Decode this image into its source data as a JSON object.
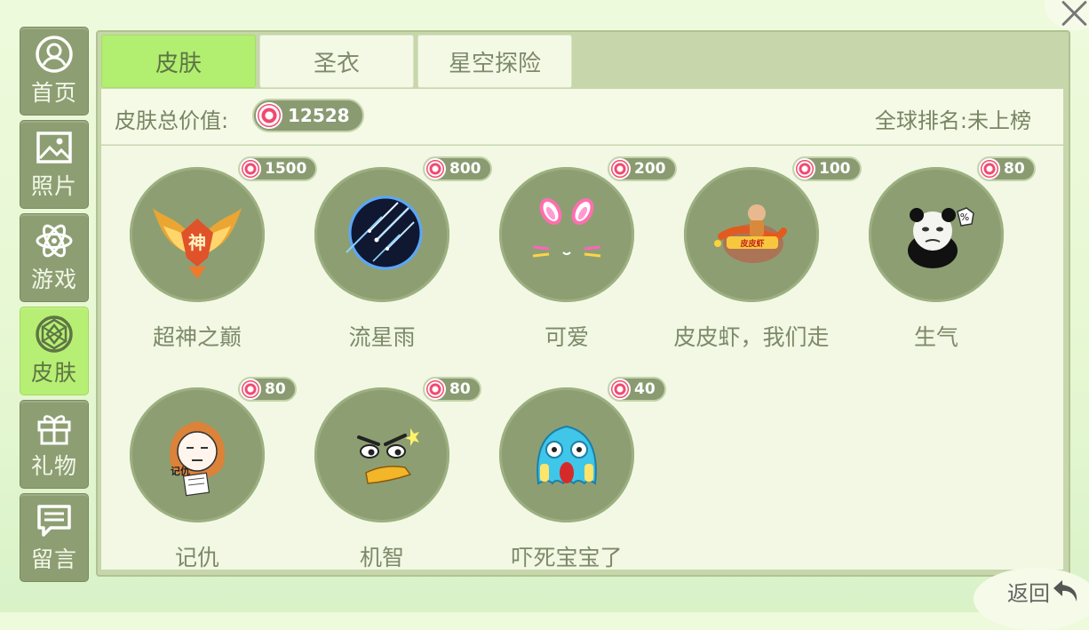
{
  "sidebar": {
    "items": [
      {
        "label": "首页",
        "icon": "user-circle-icon",
        "active": false
      },
      {
        "label": "照片",
        "icon": "picture-icon",
        "active": false
      },
      {
        "label": "游戏",
        "icon": "atom-icon",
        "active": false
      },
      {
        "label": "皮肤",
        "icon": "gem-icon",
        "active": true
      },
      {
        "label": "礼物",
        "icon": "gift-icon",
        "active": false
      },
      {
        "label": "留言",
        "icon": "message-icon",
        "active": false
      }
    ]
  },
  "tabs": [
    {
      "label": "皮肤",
      "active": true
    },
    {
      "label": "圣衣",
      "active": false
    },
    {
      "label": "星空探险",
      "active": false
    }
  ],
  "summary": {
    "total_label": "皮肤总价值:",
    "total_value": "12528",
    "rank": "全球排名:未上榜"
  },
  "skins": [
    {
      "name": "超神之巅",
      "price": "1500",
      "icon": "golden-wings-icon"
    },
    {
      "name": "流星雨",
      "price": "800",
      "icon": "meteor-shower-icon"
    },
    {
      "name": "可爱",
      "price": "200",
      "icon": "bunny-ears-icon"
    },
    {
      "name": "皮皮虾，我们走",
      "price": "100",
      "icon": "mantis-shrimp-rider-icon"
    },
    {
      "name": "生气",
      "price": "80",
      "icon": "angry-panda-icon"
    },
    {
      "name": "记仇",
      "price": "80",
      "icon": "grudge-face-icon"
    },
    {
      "name": "机智",
      "price": "80",
      "icon": "smug-face-icon"
    },
    {
      "name": "吓死宝宝了",
      "price": "40",
      "icon": "scared-ghost-icon"
    }
  ],
  "back_label": "返回",
  "colors": {
    "accent": "#b2ee6f",
    "panel": "#c7d6ab",
    "tile": "#8d9f72",
    "coin": "#f0486e"
  }
}
